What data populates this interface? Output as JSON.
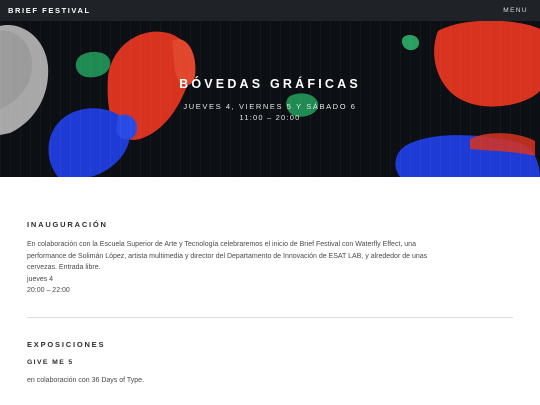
{
  "header": {
    "brand": "BRIEF FESTIVAL",
    "menu_label": "MENU"
  },
  "hero": {
    "title": "BÓVEDAS GRÁFICAS",
    "dates": "JUEVES 4, VIERNES 5 Y SÁBADO 6",
    "time": "11:00 – 20:00"
  },
  "inauguracion": {
    "heading": "INAUGURACIÓN",
    "lines": [
      "En colaboración con la Escuela Superior de Arte y Tecnología celebraremos el inicio de Brief Festival con Waterfly Effect, una",
      "performance de Solimán López, artista multimedia y director del Departamento de Innovación de ESAT LAB, y alrededor de unas",
      "cervezas. Entrada libre."
    ],
    "day": "jueves 4",
    "time": "20:00 – 22:00"
  },
  "exposiciones": {
    "heading": "EXPOSICIONES",
    "item_title": "GIVE ME 5",
    "item_text": "en colaboración con 36 Days of Type."
  },
  "colors": {
    "topbar": "#1f2227",
    "hero_bg": "#0c0f14",
    "shape_red": "#d8331f",
    "shape_blue": "#1f3bd6",
    "shape_green": "#1f8a52"
  }
}
